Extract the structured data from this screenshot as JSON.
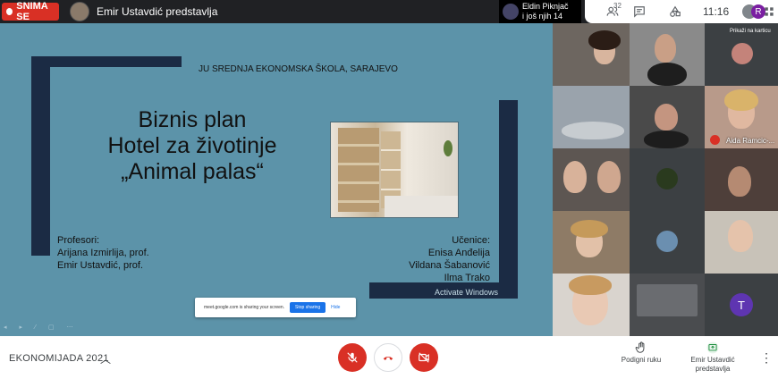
{
  "topbar": {
    "rec_label": "SNIMA SE",
    "presenter_title": "Emir Ustavdić predstavlja",
    "join_notice": {
      "line1": "Eldin Piknjač",
      "line2": "i još njih 14"
    },
    "participant_count": "32",
    "clock": "11:16",
    "avatar_letter": "R"
  },
  "slide": {
    "school": "JU SREDNJA EKONOMSKA ŠKOLA, SARAJEVO",
    "title_lines": [
      "Biznis plan",
      "Hotel za životinje",
      "„Animal palas“"
    ],
    "professors_label": "Profesori:",
    "professors": [
      "Arijana Izmirlija, prof.",
      "Emir Ustavdić, prof."
    ],
    "students_label": "Učenice:",
    "students": [
      "Enisa Anđelija",
      "Vildana Šabanović",
      "Ilma Trako"
    ],
    "activate_windows": "Activate Windows"
  },
  "share_bar": {
    "text": "meet.google.com is sharing your screen.",
    "stop": "Stop sharing",
    "hide": "Hide"
  },
  "grid": {
    "pin_chip": "Prikaži na karticu",
    "tile_name": "Aida Ramcic-...",
    "t_letter": "T"
  },
  "bottombar": {
    "meeting_name": "EKONOMIJADA 2021",
    "raise_hand": "Podigni ruku",
    "presenting": [
      "Emir Ustavdić",
      "predstavlja"
    ]
  },
  "colors": {
    "slide_bg": "#5c93a9",
    "frame": "#1b2b44",
    "danger": "#d93025",
    "accent": "#1a73e8"
  }
}
